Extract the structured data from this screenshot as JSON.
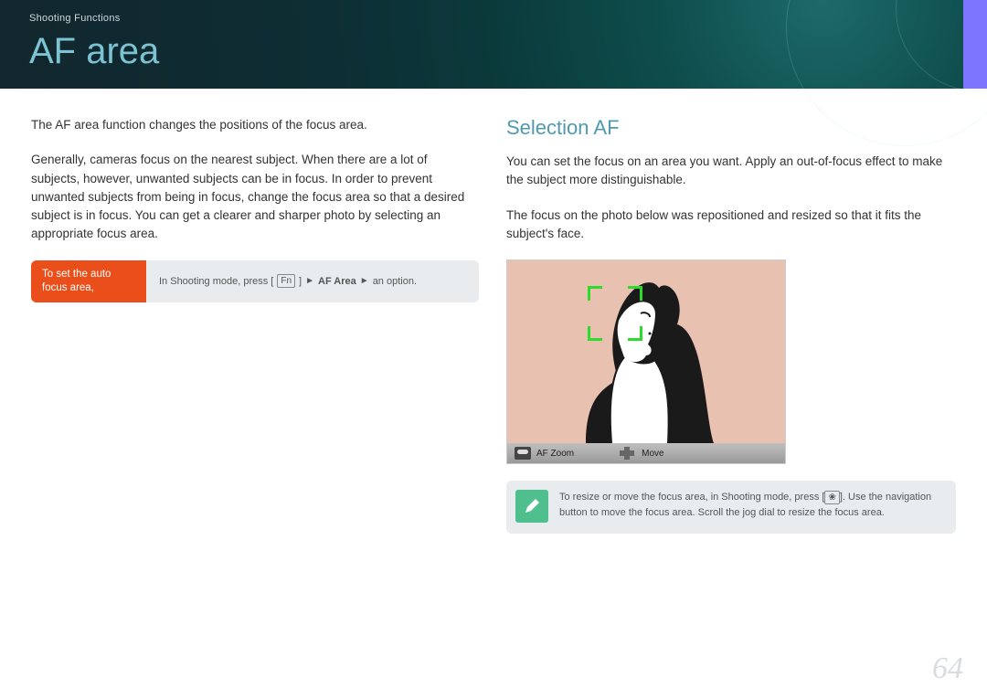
{
  "header": {
    "breadcrumb": "Shooting Functions",
    "title": "AF area"
  },
  "left": {
    "intro": "The AF area function changes the positions of the focus area.",
    "body": "Generally, cameras focus on the nearest subject. When there are a lot of subjects, however, unwanted subjects can be in focus. In order to prevent unwanted subjects from being in focus, change the focus area so that a desired subject is in focus. You can get a clearer and sharper photo by selecting an appropriate focus area.",
    "instruct": {
      "label": "To set the auto focus area,",
      "prefix": "In Shooting mode, press [",
      "key": "Fn",
      "mid1": "] ",
      "arrow": "►",
      "af_area": "AF Area",
      "suffix": " an option."
    }
  },
  "right": {
    "section_title": "Selection AF",
    "p1": "You can set the focus on an area you want. Apply an out-of-focus effect to make the subject more distinguishable.",
    "p2": "The focus on the photo below was repositioned and resized so that it fits the subject's face.",
    "viewfinder": {
      "af_zoom": "AF Zoom",
      "move": "Move"
    },
    "note": {
      "text_1": "To resize or move the focus area, in Shooting mode, press [",
      "key": "❀",
      "text_2": "]. Use the navigation button to move the focus area. Scroll the jog dial to resize the focus area."
    }
  },
  "page_number": "64"
}
